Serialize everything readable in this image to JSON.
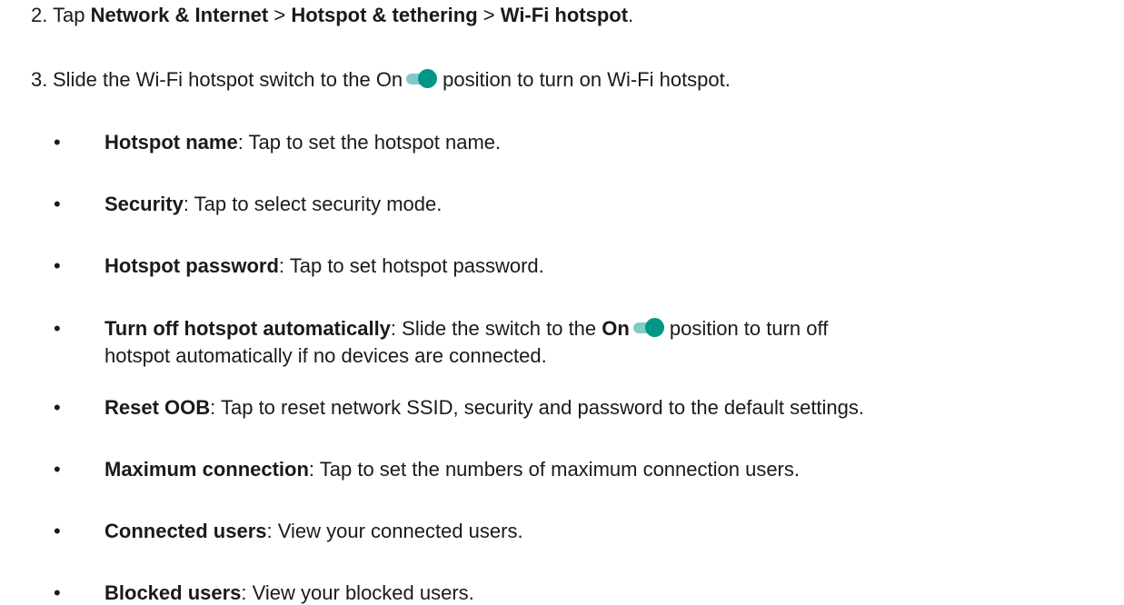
{
  "steps": [
    {
      "number": "2.",
      "tap": "Tap",
      "path1": "Network & Internet",
      "sep1": ">",
      "path2": "Hotspot & tethering",
      "sep2": ">",
      "path3": "Wi-Fi hotspot",
      "end": "."
    },
    {
      "number": "3.",
      "before": "Slide the Wi-Fi hotspot switch to the On",
      "after": "position to turn on Wi-Fi hotspot."
    }
  ],
  "bullet_symbol": "•",
  "bullets": [
    {
      "term": "Hotspot name",
      "desc": ": Tap to set the hotspot name."
    },
    {
      "term": "Security",
      "desc": ": Tap to select security mode."
    },
    {
      "term": "Hotspot password",
      "desc": ": Tap to set hotspot password."
    },
    {
      "term": "Turn off hotspot automatically",
      "desc_a": ": Slide the switch to the",
      "on": "On",
      "desc_b": "position to turn off",
      "desc_c": "hotspot automatically if no devices are connected."
    },
    {
      "term": "Reset OOB",
      "desc": ": Tap to reset network SSID, security and password to the default settings."
    },
    {
      "term": "Maximum connection",
      "desc": ":  Tap to set the numbers of maximum connection users."
    },
    {
      "term": "Connected users",
      "desc": ": View your connected users."
    },
    {
      "term": "Blocked users",
      "desc": ": View your blocked users."
    }
  ],
  "toggle_state": "on",
  "colors": {
    "text": "#1a1a1a",
    "toggle_track": "#80cbc4",
    "toggle_knob": "#009688"
  }
}
